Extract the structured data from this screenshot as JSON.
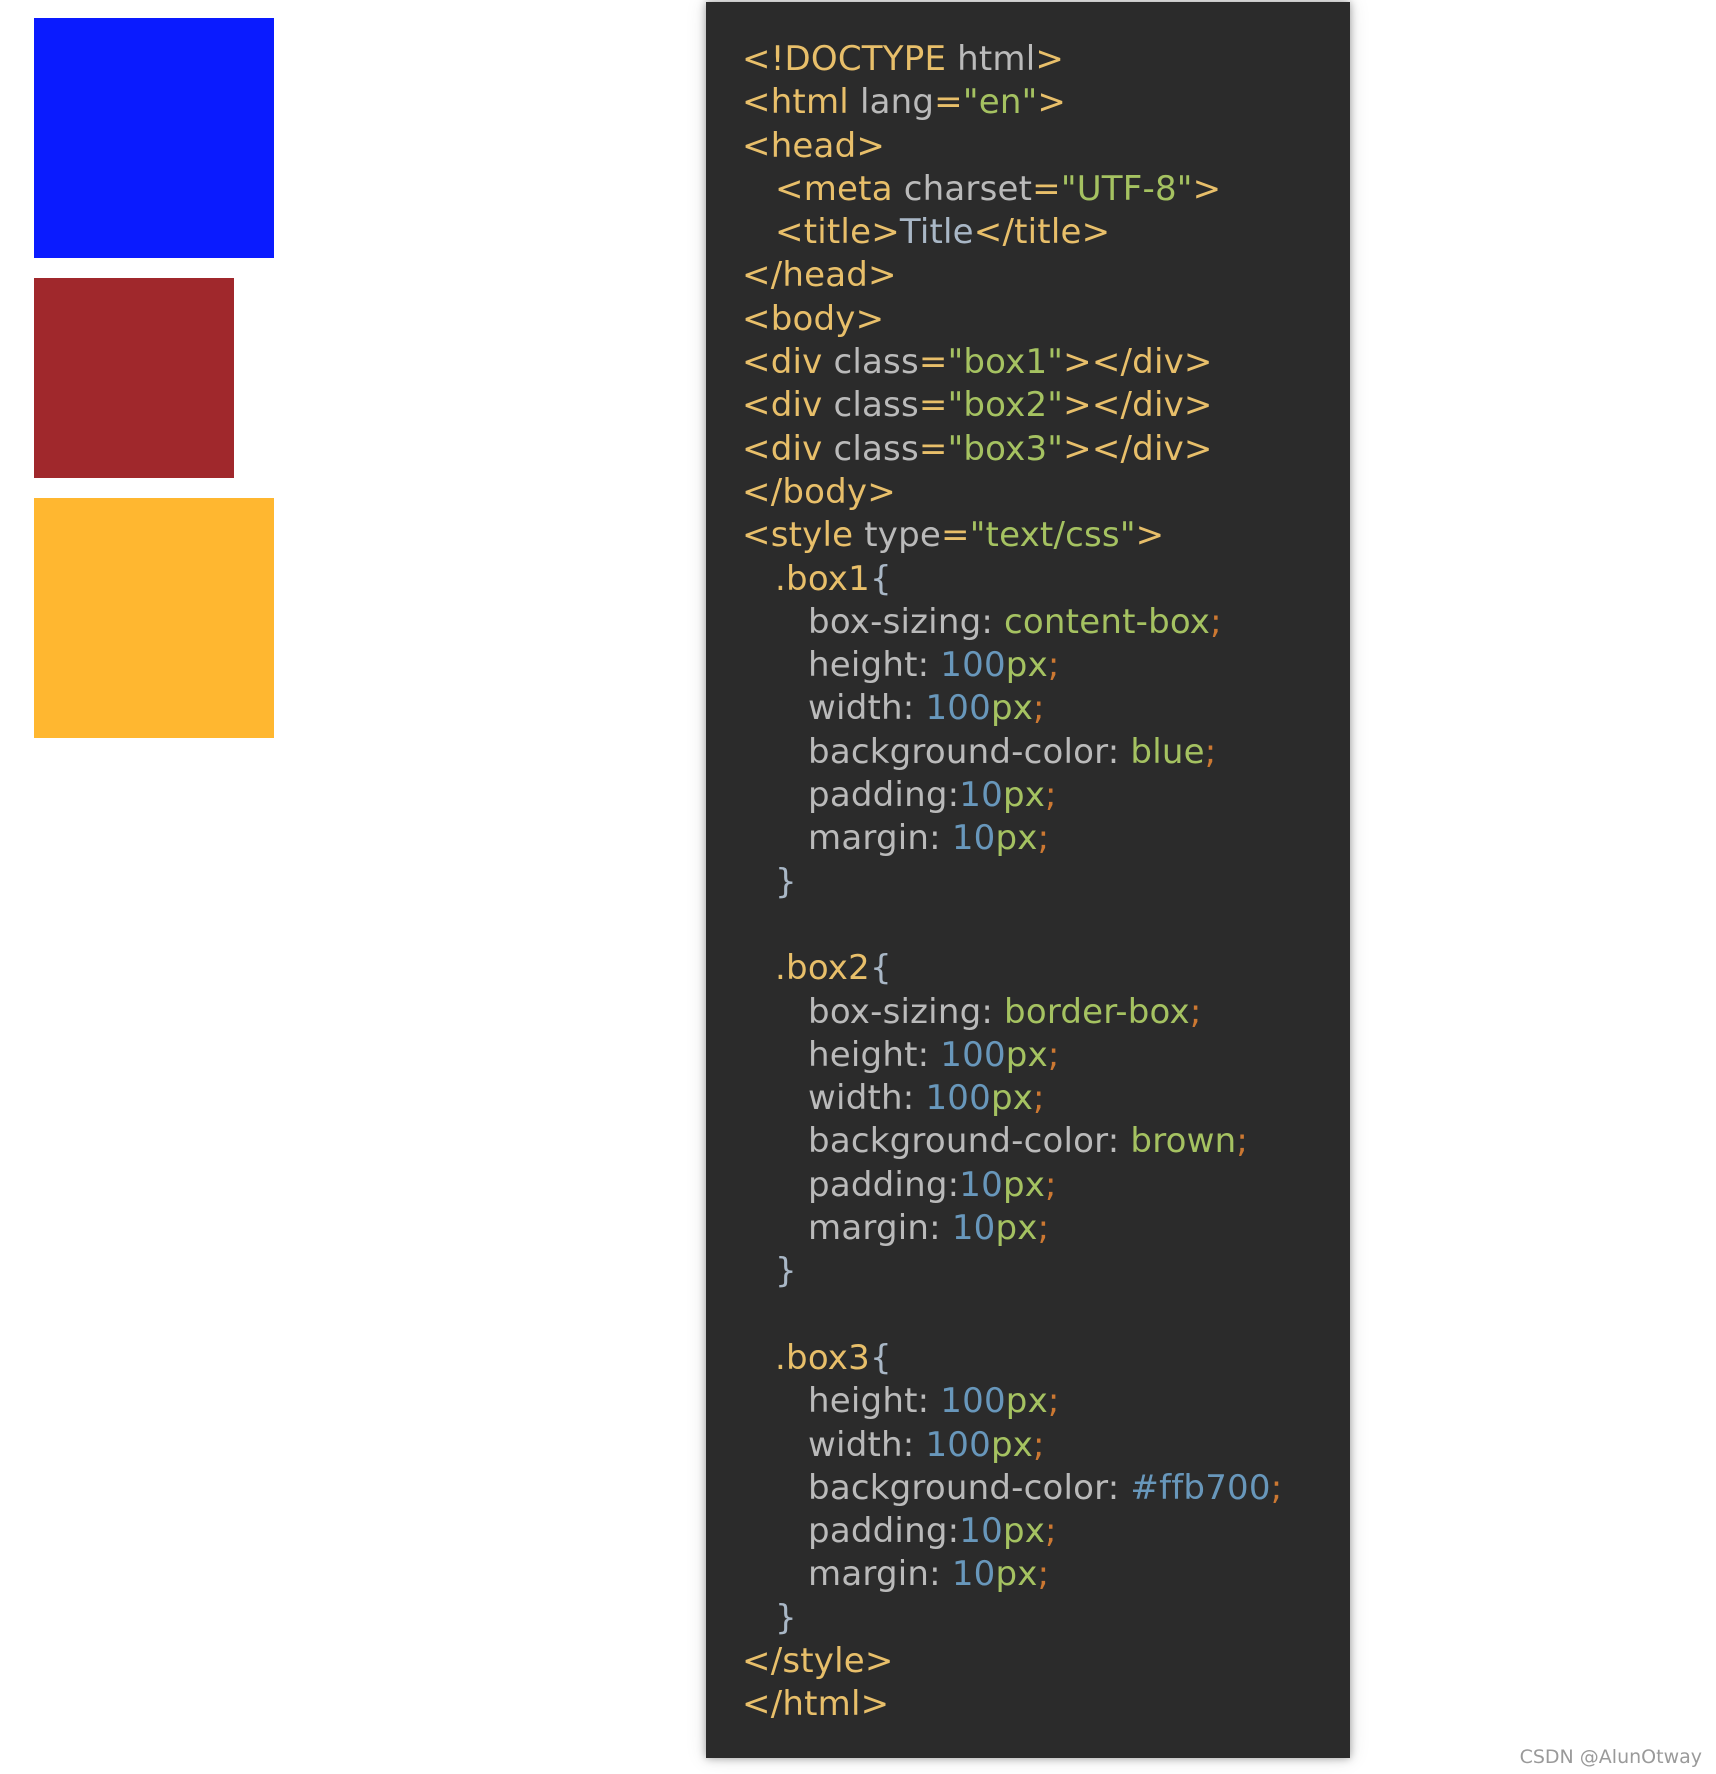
{
  "boxes": [
    {
      "id": "box1",
      "color": "#0a1bff"
    },
    {
      "id": "box2",
      "color": "#a0282c"
    },
    {
      "id": "box3",
      "color": "#ffb730"
    }
  ],
  "code_lines": [
    [
      [
        "tag",
        "<!DOCTYPE "
      ],
      [
        "attr",
        "html"
      ],
      [
        "tag",
        ">"
      ]
    ],
    [
      [
        "tag",
        "<html "
      ],
      [
        "attr",
        "lang"
      ],
      [
        "punc",
        "="
      ],
      [
        "str",
        "\"en\""
      ],
      [
        "tag",
        ">"
      ]
    ],
    [
      [
        "tag",
        "<head>"
      ]
    ],
    [
      [
        "text",
        "   "
      ],
      [
        "tag",
        "<meta "
      ],
      [
        "attr",
        "charset"
      ],
      [
        "punc",
        "="
      ],
      [
        "str",
        "\"UTF-8\""
      ],
      [
        "tag",
        ">"
      ]
    ],
    [
      [
        "text",
        "   "
      ],
      [
        "tag",
        "<title>"
      ],
      [
        "text",
        "Title"
      ],
      [
        "tag",
        "</title>"
      ]
    ],
    [
      [
        "tag",
        "</head>"
      ]
    ],
    [
      [
        "tag",
        "<body>"
      ]
    ],
    [
      [
        "tag",
        "<div "
      ],
      [
        "attr",
        "class"
      ],
      [
        "punc",
        "="
      ],
      [
        "str",
        "\"box1\""
      ],
      [
        "tag",
        "></div>"
      ]
    ],
    [
      [
        "tag",
        "<div "
      ],
      [
        "attr",
        "class"
      ],
      [
        "punc",
        "="
      ],
      [
        "str",
        "\"box2\""
      ],
      [
        "tag",
        "></div>"
      ]
    ],
    [
      [
        "tag",
        "<div "
      ],
      [
        "attr",
        "class"
      ],
      [
        "punc",
        "="
      ],
      [
        "str",
        "\"box3\""
      ],
      [
        "tag",
        "></div>"
      ]
    ],
    [
      [
        "tag",
        "</body>"
      ]
    ],
    [
      [
        "tag",
        "<style "
      ],
      [
        "attr",
        "type"
      ],
      [
        "punc",
        "="
      ],
      [
        "str",
        "\"text/css\""
      ],
      [
        "tag",
        ">"
      ]
    ],
    [
      [
        "text",
        "   "
      ],
      [
        "sel",
        ".box1"
      ],
      [
        "brace",
        "{"
      ]
    ],
    [
      [
        "text",
        "      "
      ],
      [
        "prop",
        "box-sizing: "
      ],
      [
        "val",
        "content-box"
      ],
      [
        "semi",
        ";"
      ]
    ],
    [
      [
        "text",
        "      "
      ],
      [
        "prop",
        "height: "
      ],
      [
        "num",
        "100"
      ],
      [
        "unit",
        "px"
      ],
      [
        "semi",
        ";"
      ]
    ],
    [
      [
        "text",
        "      "
      ],
      [
        "prop",
        "width: "
      ],
      [
        "num",
        "100"
      ],
      [
        "unit",
        "px"
      ],
      [
        "semi",
        ";"
      ]
    ],
    [
      [
        "text",
        "      "
      ],
      [
        "prop",
        "background-color: "
      ],
      [
        "val",
        "blue"
      ],
      [
        "semi",
        ";"
      ]
    ],
    [
      [
        "text",
        "      "
      ],
      [
        "prop",
        "padding:"
      ],
      [
        "num",
        "10"
      ],
      [
        "unit",
        "px"
      ],
      [
        "semi",
        ";"
      ]
    ],
    [
      [
        "text",
        "      "
      ],
      [
        "prop",
        "margin: "
      ],
      [
        "num",
        "10"
      ],
      [
        "unit",
        "px"
      ],
      [
        "semi",
        ";"
      ]
    ],
    [
      [
        "text",
        "   "
      ],
      [
        "brace",
        "}"
      ]
    ],
    [],
    [
      [
        "text",
        "   "
      ],
      [
        "sel",
        ".box2"
      ],
      [
        "brace",
        "{"
      ]
    ],
    [
      [
        "text",
        "      "
      ],
      [
        "prop",
        "box-sizing: "
      ],
      [
        "val",
        "border-box"
      ],
      [
        "semi",
        ";"
      ]
    ],
    [
      [
        "text",
        "      "
      ],
      [
        "prop",
        "height: "
      ],
      [
        "num",
        "100"
      ],
      [
        "unit",
        "px"
      ],
      [
        "semi",
        ";"
      ]
    ],
    [
      [
        "text",
        "      "
      ],
      [
        "prop",
        "width: "
      ],
      [
        "num",
        "100"
      ],
      [
        "unit",
        "px"
      ],
      [
        "semi",
        ";"
      ]
    ],
    [
      [
        "text",
        "      "
      ],
      [
        "prop",
        "background-color: "
      ],
      [
        "val",
        "brown"
      ],
      [
        "semi",
        ";"
      ]
    ],
    [
      [
        "text",
        "      "
      ],
      [
        "prop",
        "padding:"
      ],
      [
        "num",
        "10"
      ],
      [
        "unit",
        "px"
      ],
      [
        "semi",
        ";"
      ]
    ],
    [
      [
        "text",
        "      "
      ],
      [
        "prop",
        "margin: "
      ],
      [
        "num",
        "10"
      ],
      [
        "unit",
        "px"
      ],
      [
        "semi",
        ";"
      ]
    ],
    [
      [
        "text",
        "   "
      ],
      [
        "brace",
        "}"
      ]
    ],
    [],
    [
      [
        "text",
        "   "
      ],
      [
        "sel",
        ".box3"
      ],
      [
        "brace",
        "{"
      ]
    ],
    [
      [
        "text",
        "      "
      ],
      [
        "prop",
        "height: "
      ],
      [
        "num",
        "100"
      ],
      [
        "unit",
        "px"
      ],
      [
        "semi",
        ";"
      ]
    ],
    [
      [
        "text",
        "      "
      ],
      [
        "prop",
        "width: "
      ],
      [
        "num",
        "100"
      ],
      [
        "unit",
        "px"
      ],
      [
        "semi",
        ";"
      ]
    ],
    [
      [
        "text",
        "      "
      ],
      [
        "prop",
        "background-color: "
      ],
      [
        "num",
        "#ffb700"
      ],
      [
        "semi",
        ";"
      ]
    ],
    [
      [
        "text",
        "      "
      ],
      [
        "prop",
        "padding:"
      ],
      [
        "num",
        "10"
      ],
      [
        "unit",
        "px"
      ],
      [
        "semi",
        ";"
      ]
    ],
    [
      [
        "text",
        "      "
      ],
      [
        "prop",
        "margin: "
      ],
      [
        "num",
        "10"
      ],
      [
        "unit",
        "px"
      ],
      [
        "semi",
        ";"
      ]
    ],
    [
      [
        "text",
        "   "
      ],
      [
        "brace",
        "}"
      ]
    ],
    [
      [
        "tag",
        "</style>"
      ]
    ],
    [
      [
        "tag",
        "</html>"
      ]
    ]
  ],
  "watermark": "CSDN @AlunOtway"
}
